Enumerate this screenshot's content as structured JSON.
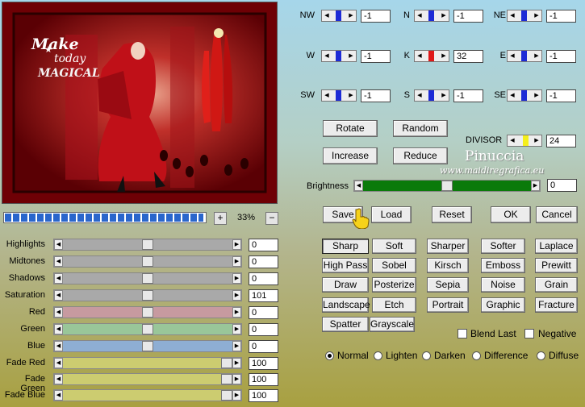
{
  "preview": {
    "artwork_text_1": "Make",
    "artwork_text_2": "today",
    "artwork_text_3": "MAGICAL"
  },
  "zoom": {
    "value": "33%",
    "plus": "+",
    "minus": "−",
    "progress_fraction": 0.99
  },
  "sliders": [
    {
      "label": "Highlights",
      "value": "0",
      "thumb_fraction": 0.5,
      "track": "#a9a9a9"
    },
    {
      "label": "Midtones",
      "value": "0",
      "thumb_fraction": 0.5,
      "track": "#a9a9a9"
    },
    {
      "label": "Shadows",
      "value": "0",
      "thumb_fraction": 0.5,
      "track": "#a9a9a9"
    },
    {
      "label": "Saturation",
      "value": "101",
      "thumb_fraction": 0.5,
      "track": "#a9a9a9"
    },
    {
      "label": "Red",
      "value": "0",
      "thumb_fraction": 0.5,
      "track": "#c79aa0"
    },
    {
      "label": "Green",
      "value": "0",
      "thumb_fraction": 0.5,
      "track": "#99c699"
    },
    {
      "label": "Blue",
      "value": "0",
      "thumb_fraction": 0.5,
      "track": "#8eaed3"
    },
    {
      "label": "Fade Red",
      "value": "100",
      "thumb_fraction": 1.0,
      "track": "#cccc70"
    },
    {
      "label": "Fade Green",
      "value": "100",
      "thumb_fraction": 1.0,
      "track": "#cccc70"
    },
    {
      "label": "Fade Blue",
      "value": "100",
      "thumb_fraction": 1.0,
      "track": "#cccc70"
    }
  ],
  "kernel": [
    {
      "label": "NW",
      "value": "-1"
    },
    {
      "label": "N",
      "value": "-1"
    },
    {
      "label": "NE",
      "value": "-1"
    },
    {
      "label": "W",
      "value": "-1"
    },
    {
      "label": "K",
      "value": "32"
    },
    {
      "label": "E",
      "value": "-1"
    },
    {
      "label": "SW",
      "value": "-1"
    },
    {
      "label": "S",
      "value": "-1"
    },
    {
      "label": "SE",
      "value": "-1"
    }
  ],
  "buttons": {
    "rotate": "Rotate",
    "random": "Random",
    "increase": "Increase",
    "reduce": "Reduce",
    "save": "Save",
    "load": "Load",
    "reset": "Reset",
    "ok": "OK",
    "cancel": "Cancel"
  },
  "divisor": {
    "label": "DIVISOR",
    "value": "24"
  },
  "brand": {
    "name": "Pinuccia",
    "url": "www.maidiregrafica.eu"
  },
  "brightness": {
    "label": "Brightness",
    "value": "0",
    "thumb_fraction": 0.5,
    "track": "#0a7a0a"
  },
  "presets": [
    [
      "Sharp",
      "Soft",
      "Sharper",
      "Softer",
      "Laplace"
    ],
    [
      "High Pass",
      "Sobel",
      "Kirsch",
      "Emboss",
      "Prewitt"
    ],
    [
      "Draw",
      "Posterize",
      "Sepia",
      "Noise",
      "Grain"
    ],
    [
      "Landscape",
      "Etch",
      "Portrait",
      "Graphic",
      "Fracture"
    ],
    [
      "Spatter",
      "Grayscale"
    ]
  ],
  "selected_preset": "Sharp",
  "checkboxes": {
    "blend_last": "Blend Last",
    "negative": "Negative"
  },
  "modes": [
    "Normal",
    "Lighten",
    "Darken",
    "Difference",
    "Diffuse"
  ],
  "selected_mode": "Normal"
}
